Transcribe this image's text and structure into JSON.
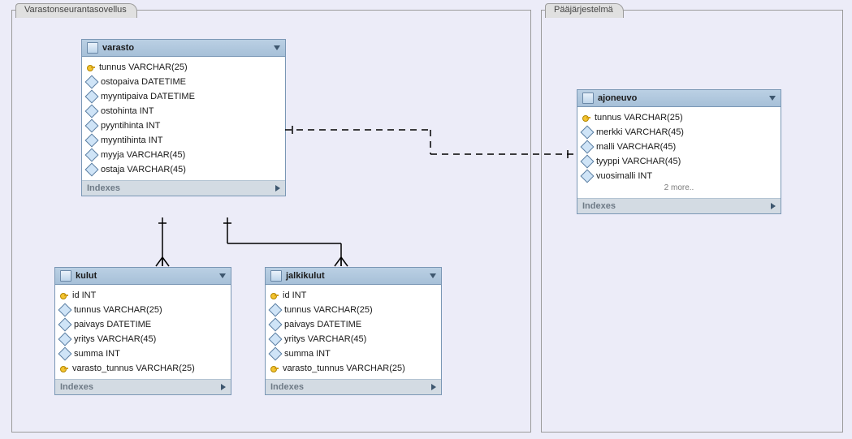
{
  "regions": {
    "left": "Varastonseurantasovellus",
    "right": "Pääjärjestelmä"
  },
  "indexes_label": "Indexes",
  "tables": {
    "varasto": {
      "name": "varasto",
      "cols": [
        {
          "k": true,
          "t": "tunnus VARCHAR(25)"
        },
        {
          "k": false,
          "t": "ostopaiva DATETIME"
        },
        {
          "k": false,
          "t": "myyntipaiva DATETIME"
        },
        {
          "k": false,
          "t": "ostohinta INT"
        },
        {
          "k": false,
          "t": "pyyntihinta INT"
        },
        {
          "k": false,
          "t": "myyntihinta INT"
        },
        {
          "k": false,
          "t": "myyja VARCHAR(45)"
        },
        {
          "k": false,
          "t": "ostaja VARCHAR(45)"
        }
      ]
    },
    "kulut": {
      "name": "kulut",
      "cols": [
        {
          "k": true,
          "t": "id INT"
        },
        {
          "k": false,
          "t": "tunnus VARCHAR(25)"
        },
        {
          "k": false,
          "t": "paivays DATETIME"
        },
        {
          "k": false,
          "t": "yritys VARCHAR(45)"
        },
        {
          "k": false,
          "t": "summa INT"
        },
        {
          "k": true,
          "t": "varasto_tunnus VARCHAR(25)"
        }
      ]
    },
    "jalkikulut": {
      "name": "jalkikulut",
      "cols": [
        {
          "k": true,
          "t": "id INT"
        },
        {
          "k": false,
          "t": "tunnus VARCHAR(25)"
        },
        {
          "k": false,
          "t": "paivays DATETIME"
        },
        {
          "k": false,
          "t": "yritys VARCHAR(45)"
        },
        {
          "k": false,
          "t": "summa INT"
        },
        {
          "k": true,
          "t": "varasto_tunnus VARCHAR(25)"
        }
      ]
    },
    "ajoneuvo": {
      "name": "ajoneuvo",
      "more": "2 more..",
      "cols": [
        {
          "k": true,
          "t": "tunnus VARCHAR(25)"
        },
        {
          "k": false,
          "t": "merkki VARCHAR(45)"
        },
        {
          "k": false,
          "t": "malli VARCHAR(45)"
        },
        {
          "k": false,
          "t": "tyyppi VARCHAR(45)"
        },
        {
          "k": false,
          "t": "vuosimalli INT"
        }
      ]
    }
  }
}
